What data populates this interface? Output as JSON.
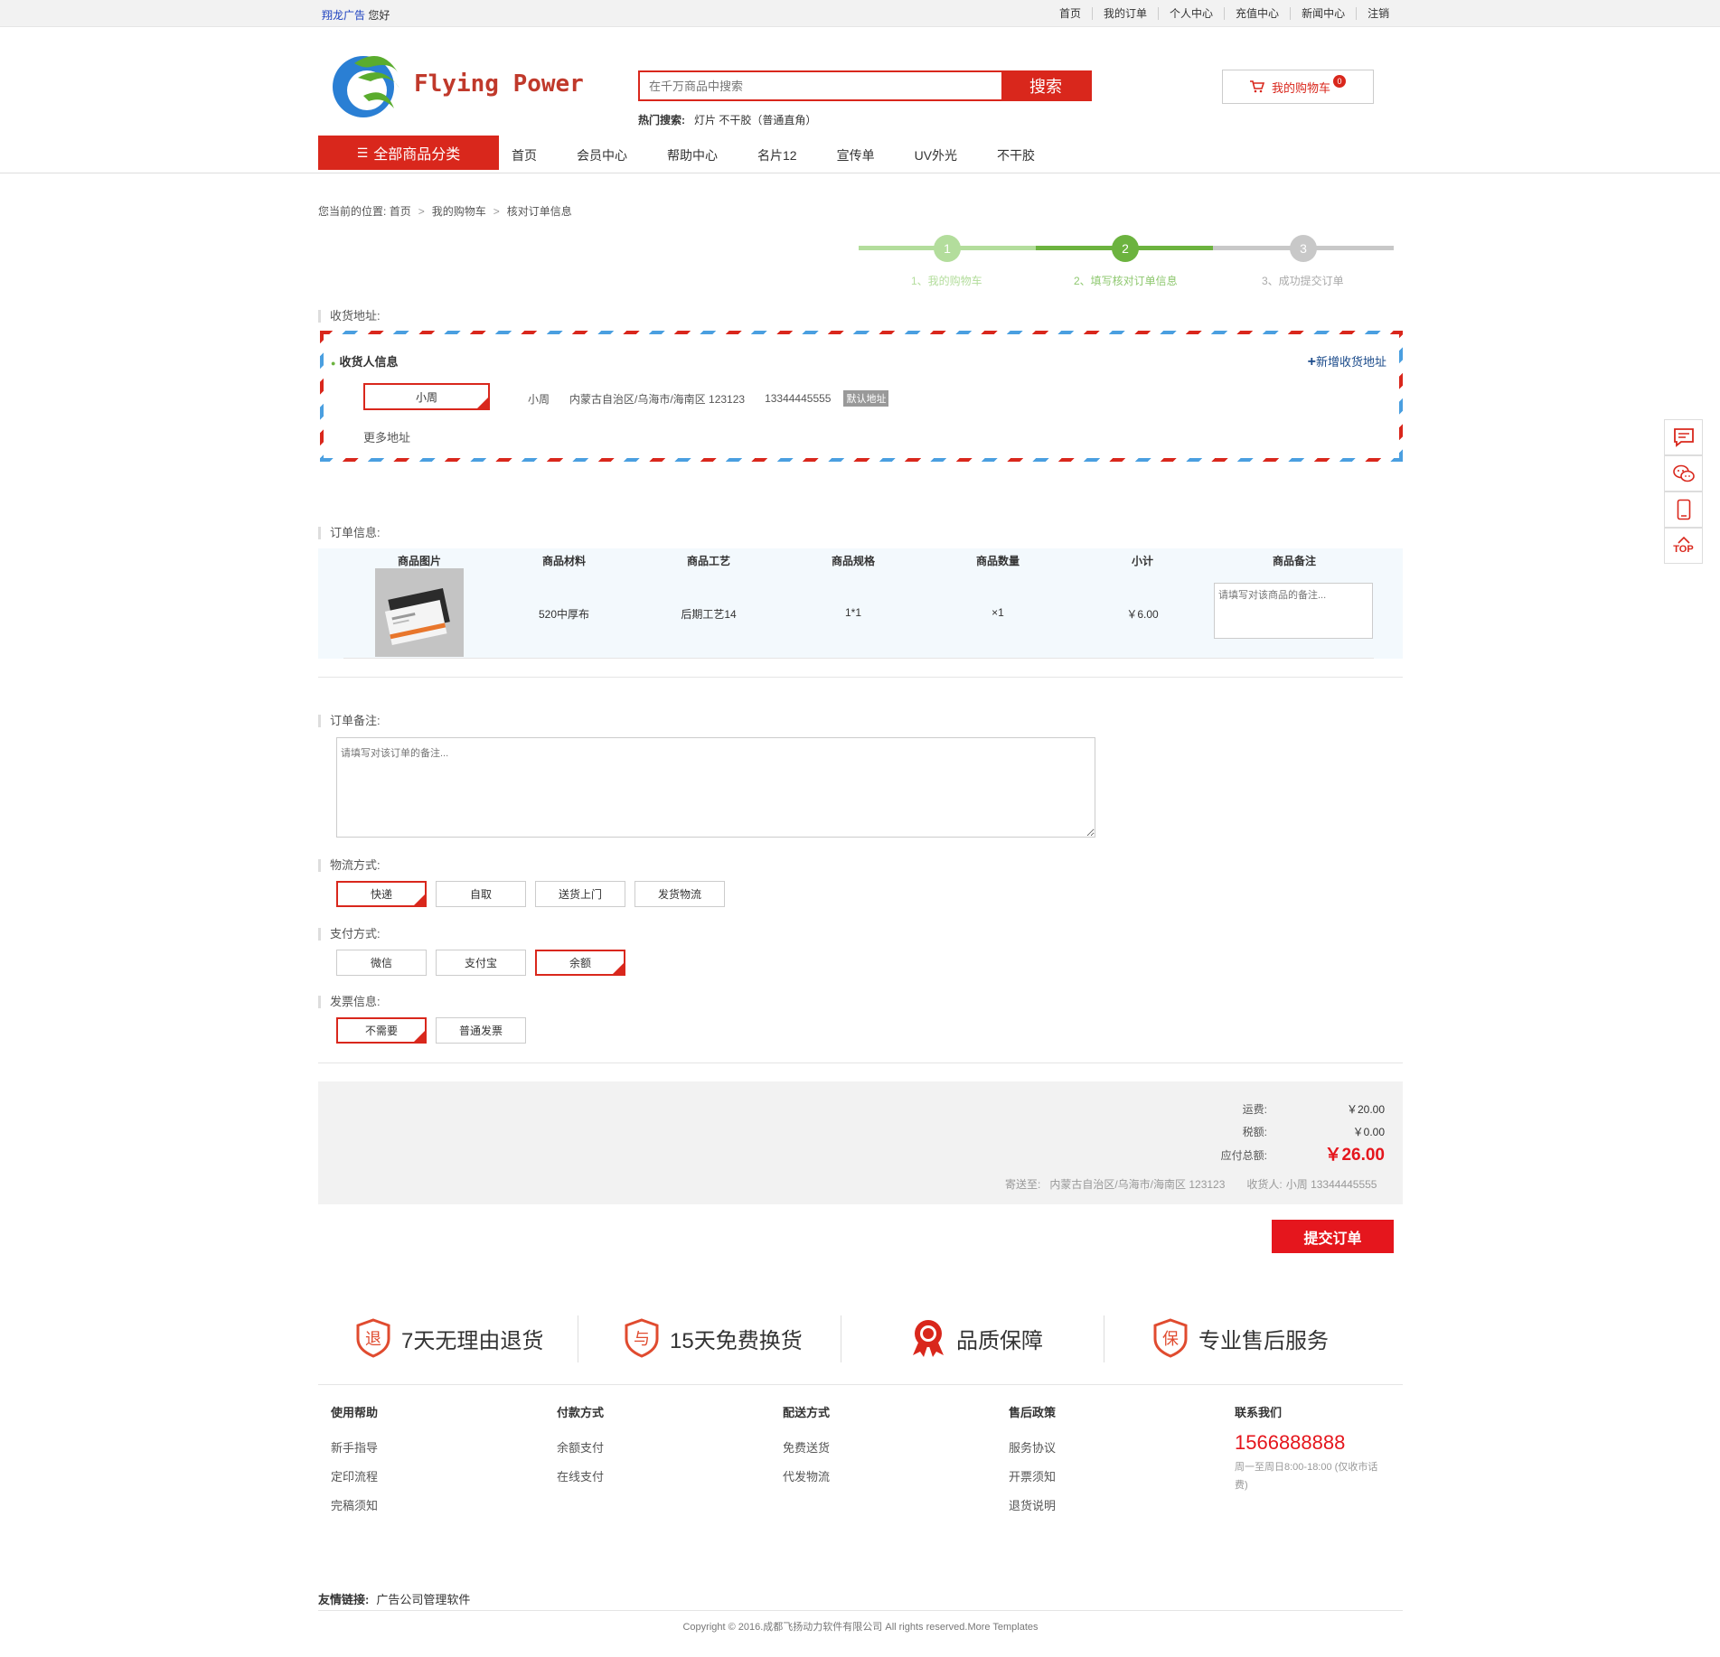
{
  "topbar": {
    "site_link": "翔龙广告",
    "greeting": "您好",
    "links": [
      "首页",
      "我的订单",
      "个人中心",
      "充值中心",
      "新闻中心",
      "注销"
    ]
  },
  "header": {
    "logo_text": "Flying Power",
    "search_placeholder": "在千万商品中搜索",
    "search_button": "搜索",
    "hot_label": "热门搜索:",
    "hot_terms": "灯片 不干胶（普通直角）",
    "cart_label": "我的购物车",
    "cart_count": "0"
  },
  "nav": {
    "all_categories": "全部商品分类",
    "items": [
      "首页",
      "会员中心",
      "帮助中心",
      "名片12",
      "宣传单",
      "UV外光",
      "不干胶"
    ]
  },
  "breadcrumb": {
    "prefix": "您当前的位置:",
    "items": [
      "首页",
      "我的购物车",
      "核对订单信息"
    ]
  },
  "steps": [
    {
      "num": "1",
      "label": "1、我的购物车"
    },
    {
      "num": "2",
      "label": "2、填写核对订单信息"
    },
    {
      "num": "3",
      "label": "3、成功提交订单"
    }
  ],
  "address": {
    "section_title": "收货地址:",
    "receiver_title": "收货人信息",
    "add_new": "新增收货地址",
    "selected_name": "小周",
    "name": "小周",
    "detail": "内蒙古自治区/乌海市/海南区 123123",
    "phone": "13344445555",
    "default_badge": "默认地址",
    "more": "更多地址"
  },
  "order": {
    "section_title": "订单信息:",
    "columns": [
      "商品图片",
      "商品材料",
      "商品工艺",
      "商品规格",
      "商品数量",
      "小计",
      "商品备注"
    ],
    "row": {
      "material": "520中厚布",
      "craft": "后期工艺14",
      "spec": "1*1",
      "qty": "×1",
      "subtotal": "￥6.00",
      "note_placeholder": "请填写对该商品的备注..."
    }
  },
  "remark": {
    "section_title": "订单备注:",
    "placeholder": "请填写对该订单的备注..."
  },
  "shipping": {
    "section_title": "物流方式:",
    "options": [
      "快递",
      "自取",
      "送货上门",
      "发货物流"
    ],
    "selected": "快递"
  },
  "payment": {
    "section_title": "支付方式:",
    "options": [
      "微信",
      "支付宝",
      "余额"
    ],
    "selected": "余额"
  },
  "invoice": {
    "section_title": "发票信息:",
    "options": [
      "不需要",
      "普通发票"
    ],
    "selected": "不需要"
  },
  "summary": {
    "freight_label": "运费:",
    "freight": "￥20.00",
    "tax_label": "税额:",
    "tax": "￥0.00",
    "total_label": "应付总额:",
    "total": "￥26.00",
    "ship_to_label": "寄送至:",
    "ship_to": "内蒙古自治区/乌海市/海南区 123123",
    "receiver_label": "收货人:",
    "receiver": "小周 13344445555",
    "submit": "提交订单"
  },
  "guarantees": [
    "7天无理由退货",
    "15天免费换货",
    "品质保障",
    "专业售后服务"
  ],
  "footer": {
    "cols": [
      {
        "title": "使用帮助",
        "items": [
          "新手指导",
          "定印流程",
          "完稿须知"
        ]
      },
      {
        "title": "付款方式",
        "items": [
          "余额支付",
          "在线支付"
        ]
      },
      {
        "title": "配送方式",
        "items": [
          "免费送货",
          "代发物流"
        ]
      },
      {
        "title": "售后政策",
        "items": [
          "服务协议",
          "开票须知",
          "退货说明"
        ]
      }
    ],
    "contact_title": "联系我们",
    "phone": "1566888888",
    "hours": "周一至周日8:00-18:00 (仅收市话费)",
    "links_label": "友情链接:",
    "links": "广告公司管理软件",
    "copyright": "Copyright © 2016.成都飞扬动力软件有限公司 All rights reserved.More Templates"
  },
  "colors": {
    "accent": "#d9271c",
    "step_green": "#6cb33f",
    "step_light": "#b3dd9c",
    "step_gray": "#c8c8c8"
  }
}
